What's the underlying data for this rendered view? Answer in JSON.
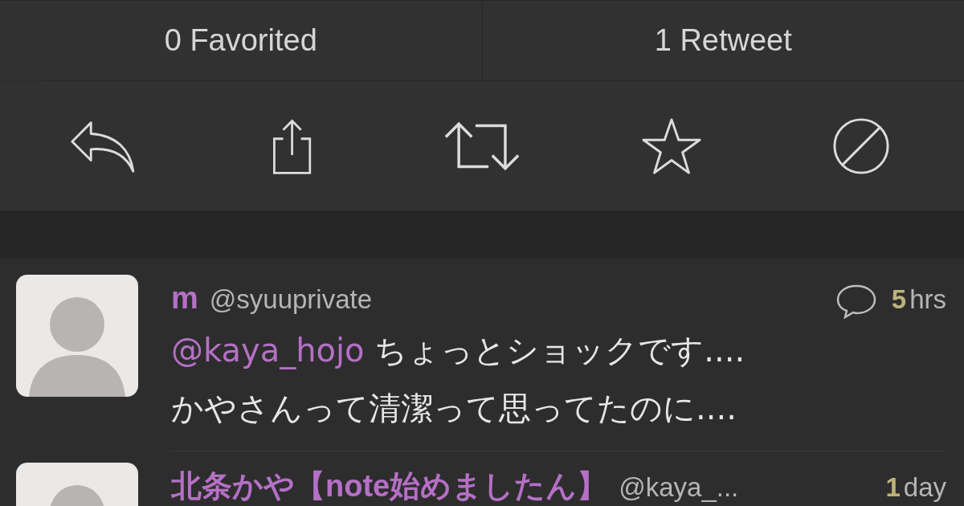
{
  "counts": [
    {
      "label": "0 Favorited"
    },
    {
      "label": "1 Retweet"
    }
  ],
  "actions": [
    {
      "kind": "reply"
    },
    {
      "kind": "share"
    },
    {
      "kind": "retweet"
    },
    {
      "kind": "favorite"
    },
    {
      "kind": "mute"
    }
  ],
  "tweets": [
    {
      "name": "m",
      "handle": "@syuuprivate",
      "has_conversation": true,
      "time_value": "5",
      "time_unit": "hrs",
      "mention": "@kaya_hojo",
      "text": " ちょっとショックです....\nかやさんって清潔って思ってたのに...."
    },
    {
      "name": "北条かや【note始めましたん】",
      "handle": "@kaya_...",
      "has_conversation": false,
      "time_value": "1",
      "time_unit": "day"
    }
  ]
}
